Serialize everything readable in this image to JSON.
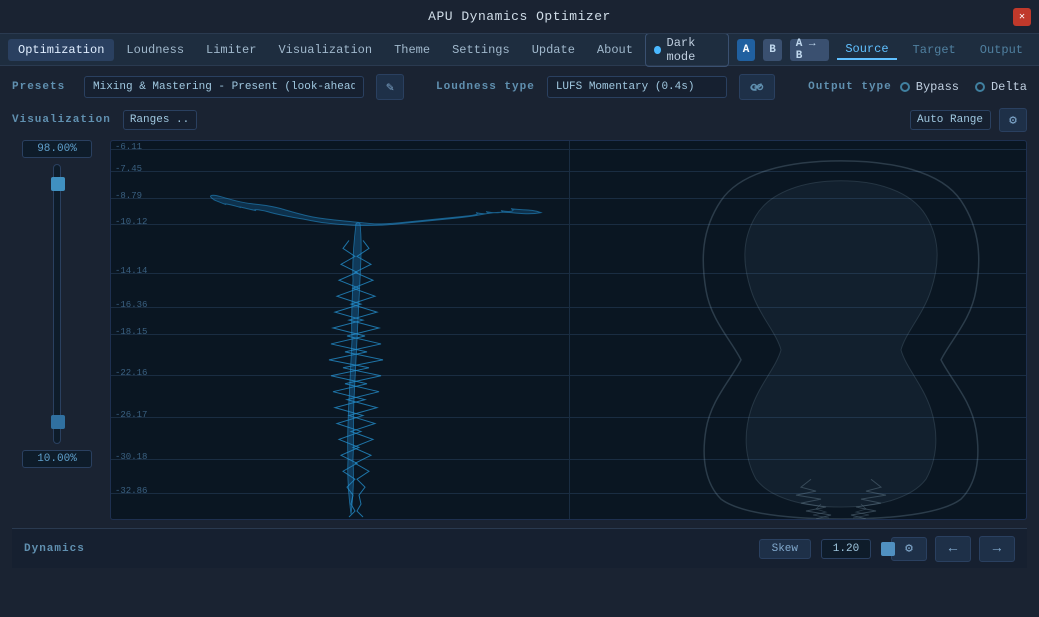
{
  "window": {
    "title": "APU Dynamics Optimizer"
  },
  "menu": {
    "items": [
      {
        "label": "Optimization",
        "active": true
      },
      {
        "label": "Loudness"
      },
      {
        "label": "Limiter"
      },
      {
        "label": "Visualization"
      },
      {
        "label": "Theme"
      },
      {
        "label": "Settings"
      },
      {
        "label": "Update"
      },
      {
        "label": "About"
      }
    ]
  },
  "toolbar": {
    "dark_mode_label": "Dark mode",
    "btn_a": "A",
    "btn_b": "B",
    "btn_ab": "A → B",
    "source_label": "Source",
    "target_label": "Target",
    "output_label": "Output"
  },
  "presets": {
    "label": "Presets",
    "value": "Mixing & Mastering - Present (look-ahead)"
  },
  "loudness": {
    "label": "Loudness type",
    "value": "LUFS Momentary (0.4s)"
  },
  "output": {
    "label": "Output type",
    "bypass_label": "Bypass",
    "delta_label": "Delta",
    "range_label": "Auto Range"
  },
  "visualization": {
    "label": "Visualization",
    "range_value": "Ranges .."
  },
  "viz_values": {
    "top_pct": "98.00%",
    "bot_pct": "10.00%"
  },
  "grid_lines": [
    {
      "label": "-6.11",
      "pct": 2
    },
    {
      "label": "-7.45",
      "pct": 8
    },
    {
      "label": "-8.79",
      "pct": 15
    },
    {
      "label": "-10.12",
      "pct": 22
    },
    {
      "label": "-14.14",
      "pct": 35
    },
    {
      "label": "-16.36",
      "pct": 44
    },
    {
      "label": "-18.15",
      "pct": 51
    },
    {
      "label": "-22.16",
      "pct": 62
    },
    {
      "label": "-26.17",
      "pct": 73
    },
    {
      "label": "-30.18",
      "pct": 84
    },
    {
      "label": "-32.86",
      "pct": 93
    }
  ],
  "dynamics": {
    "label": "Dynamics",
    "skew_label": "Skew",
    "skew_value": "1.20"
  }
}
